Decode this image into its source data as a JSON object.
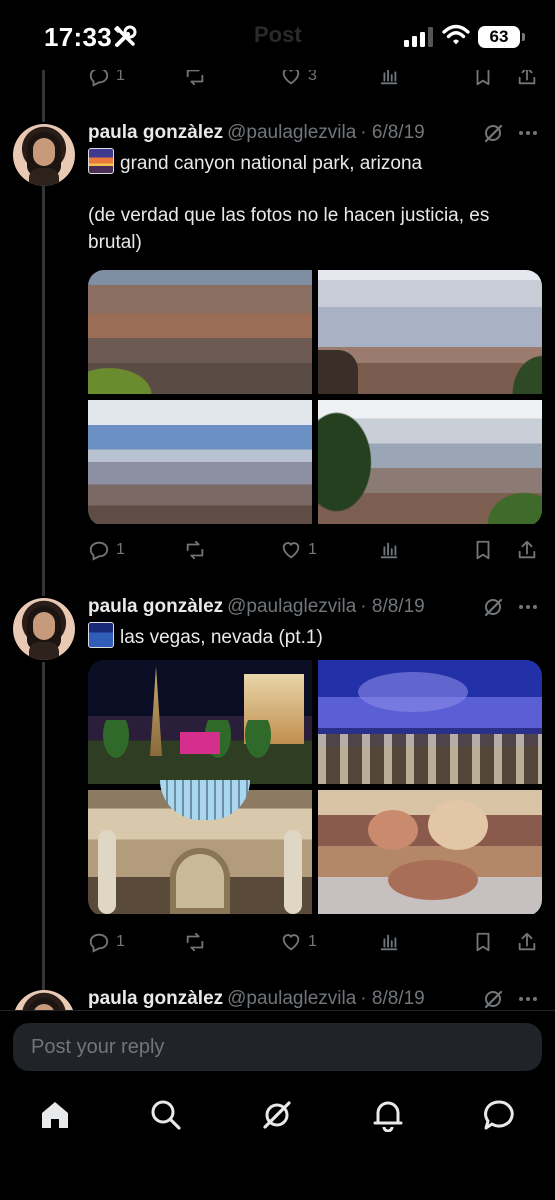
{
  "status_bar": {
    "time": "17:33",
    "title": "Post",
    "battery": "63"
  },
  "top_actions": {
    "reply_count": "1",
    "like_count": "3"
  },
  "posts": [
    {
      "name": "paula gonzàlez",
      "handle": "@paulaglezvila",
      "date": "· 6/8/19",
      "emoji": "sunset-emoji",
      "line1": "grand canyon national park, arizona",
      "body": "(de verdad que las fotos no le hacen justicia, es brutal)",
      "reply_count": "1",
      "like_count": "1",
      "photos": [
        "grand canyon canyon view",
        "grand canyon cloudy sky",
        "grand canyon river valley",
        "grand canyon pine tree overlook"
      ]
    },
    {
      "name": "paula gonzàlez",
      "handle": "@paulaglezvila",
      "date": "· 8/8/19",
      "emoji": "city-night-emoji",
      "line1": "las vegas, nevada (pt.1)",
      "reply_count": "1",
      "like_count": "1",
      "photos": [
        "las vegas strip at night",
        "caesars palace forum shops ceiling",
        "domed hall with statues",
        "fountain statue sculpture"
      ]
    },
    {
      "name": "paula gonzàlez",
      "handle": "@paulaglezvila",
      "date": "· 8/8/19"
    }
  ],
  "reply_bar": {
    "placeholder": "Post your reply"
  },
  "tab_bar": {
    "items": [
      "home-icon",
      "search-icon",
      "grok-icon",
      "notifications-icon",
      "messages-icon"
    ]
  },
  "colors": {
    "background": "#000000",
    "text": "#e7e9ea",
    "muted": "#71767b",
    "input": "#202327",
    "thread_line": "#333639"
  }
}
